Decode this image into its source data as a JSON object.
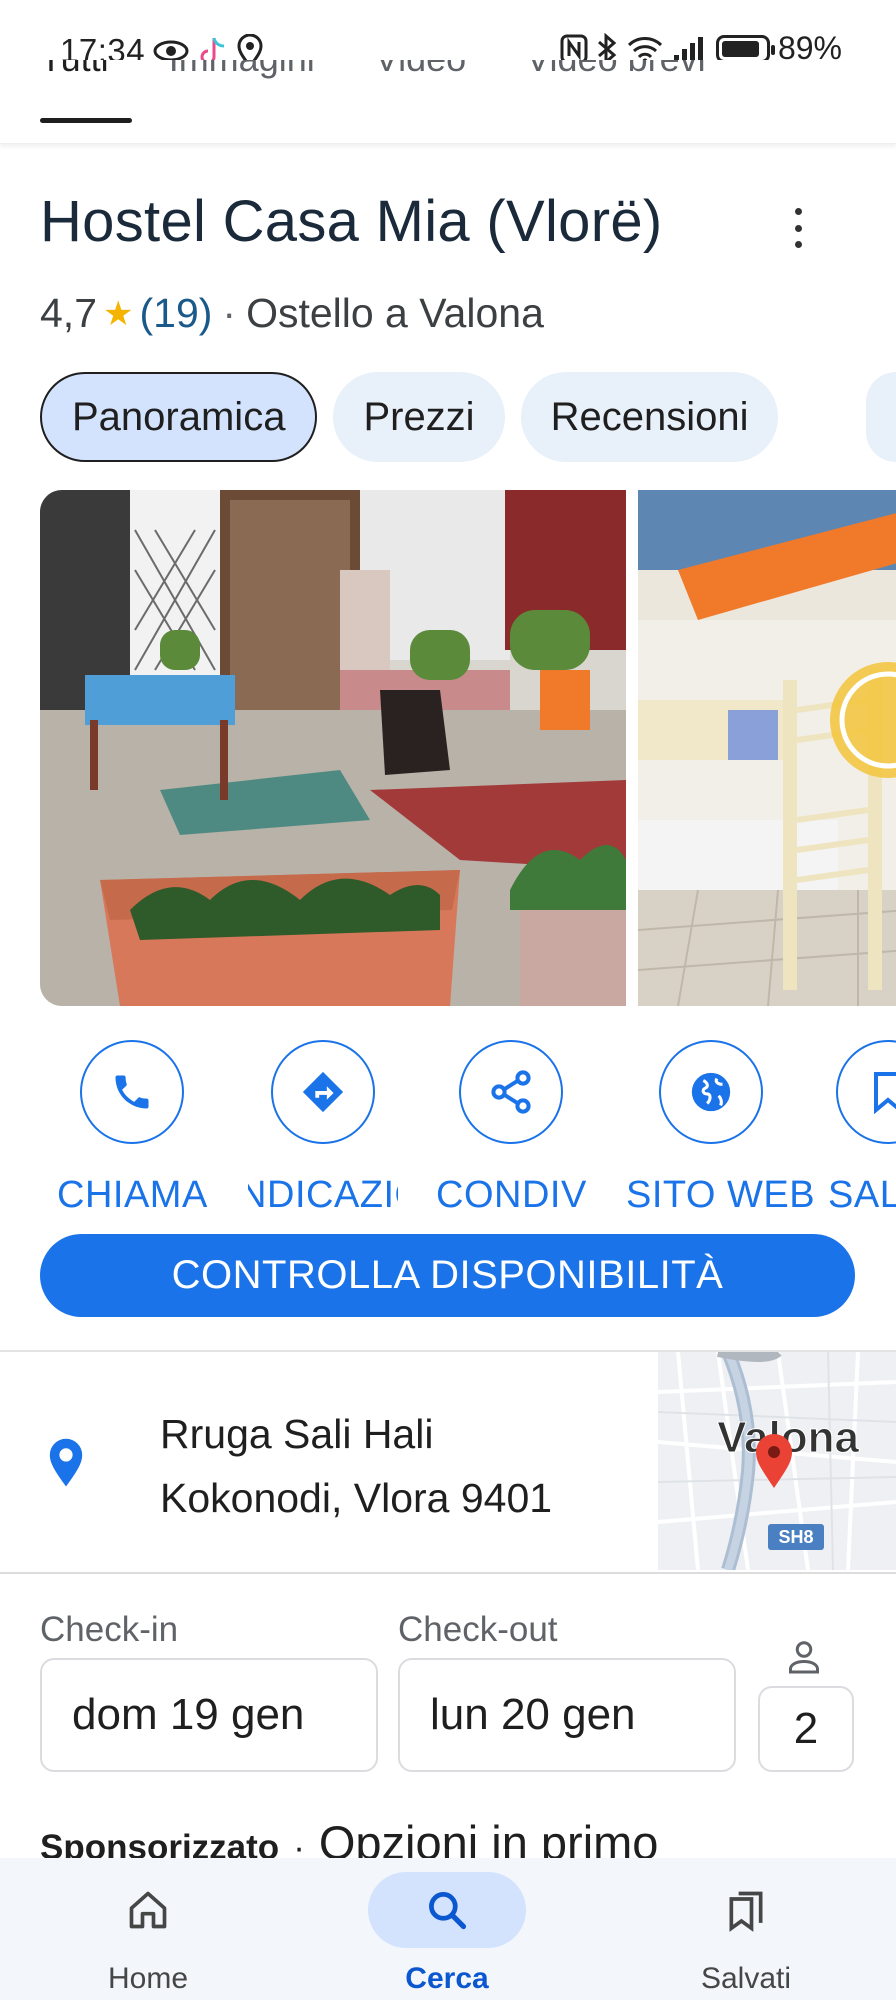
{
  "status_bar": {
    "time": "17:34",
    "battery": "89%",
    "icons_left": [
      "eye-icon",
      "tiktok-icon",
      "location-icon"
    ],
    "icons_right": [
      "nfc-icon",
      "bluetooth-icon",
      "wifi-icon",
      "signal-icon",
      "battery-icon"
    ]
  },
  "top_tabs": [
    "Tutti",
    "Immagini",
    "Video",
    "Video brevi"
  ],
  "place": {
    "name": "Hostel Casa Mia (Vlorë)",
    "rating": "4,7",
    "review_count": "(19)",
    "category": "Ostello a Valona"
  },
  "chips": [
    "Panoramica",
    "Prezzi",
    "Recensioni"
  ],
  "actions": [
    {
      "label": "CHIAMA",
      "icon": "phone-icon"
    },
    {
      "label": "INDICAZIONI",
      "icon": "directions-icon"
    },
    {
      "label": "CONDIVIDI",
      "icon": "share-icon"
    },
    {
      "label": "SITO WEB",
      "icon": "globe-icon"
    },
    {
      "label": "SALVA",
      "icon": "bookmark-icon"
    }
  ],
  "cta": "CONTROLLA DISPONIBILITÀ",
  "address": {
    "line1": "Rruga Sali Hali",
    "line2": "Kokonodi, Vlora 9401",
    "map_city": "Valona",
    "map_road": "SH8"
  },
  "booking": {
    "checkin_label": "Check-in",
    "checkin_value": "dom 19 gen",
    "checkout_label": "Check-out",
    "checkout_value": "lun 20 gen",
    "guests": "2"
  },
  "sponsored": {
    "label": "Sponsorizzato",
    "separator": "·",
    "text": "Opzioni in primo"
  },
  "bottom_nav": [
    {
      "label": "Home",
      "icon": "home-icon"
    },
    {
      "label": "Cerca",
      "icon": "search-icon"
    },
    {
      "label": "Salvati",
      "icon": "saved-icon"
    }
  ],
  "colors": {
    "accent": "#1a73e8",
    "chip_bg": "#e8f0fa",
    "chip_active": "#d3e3fd",
    "star": "#f4b400",
    "map_pin": "#ea4335"
  }
}
